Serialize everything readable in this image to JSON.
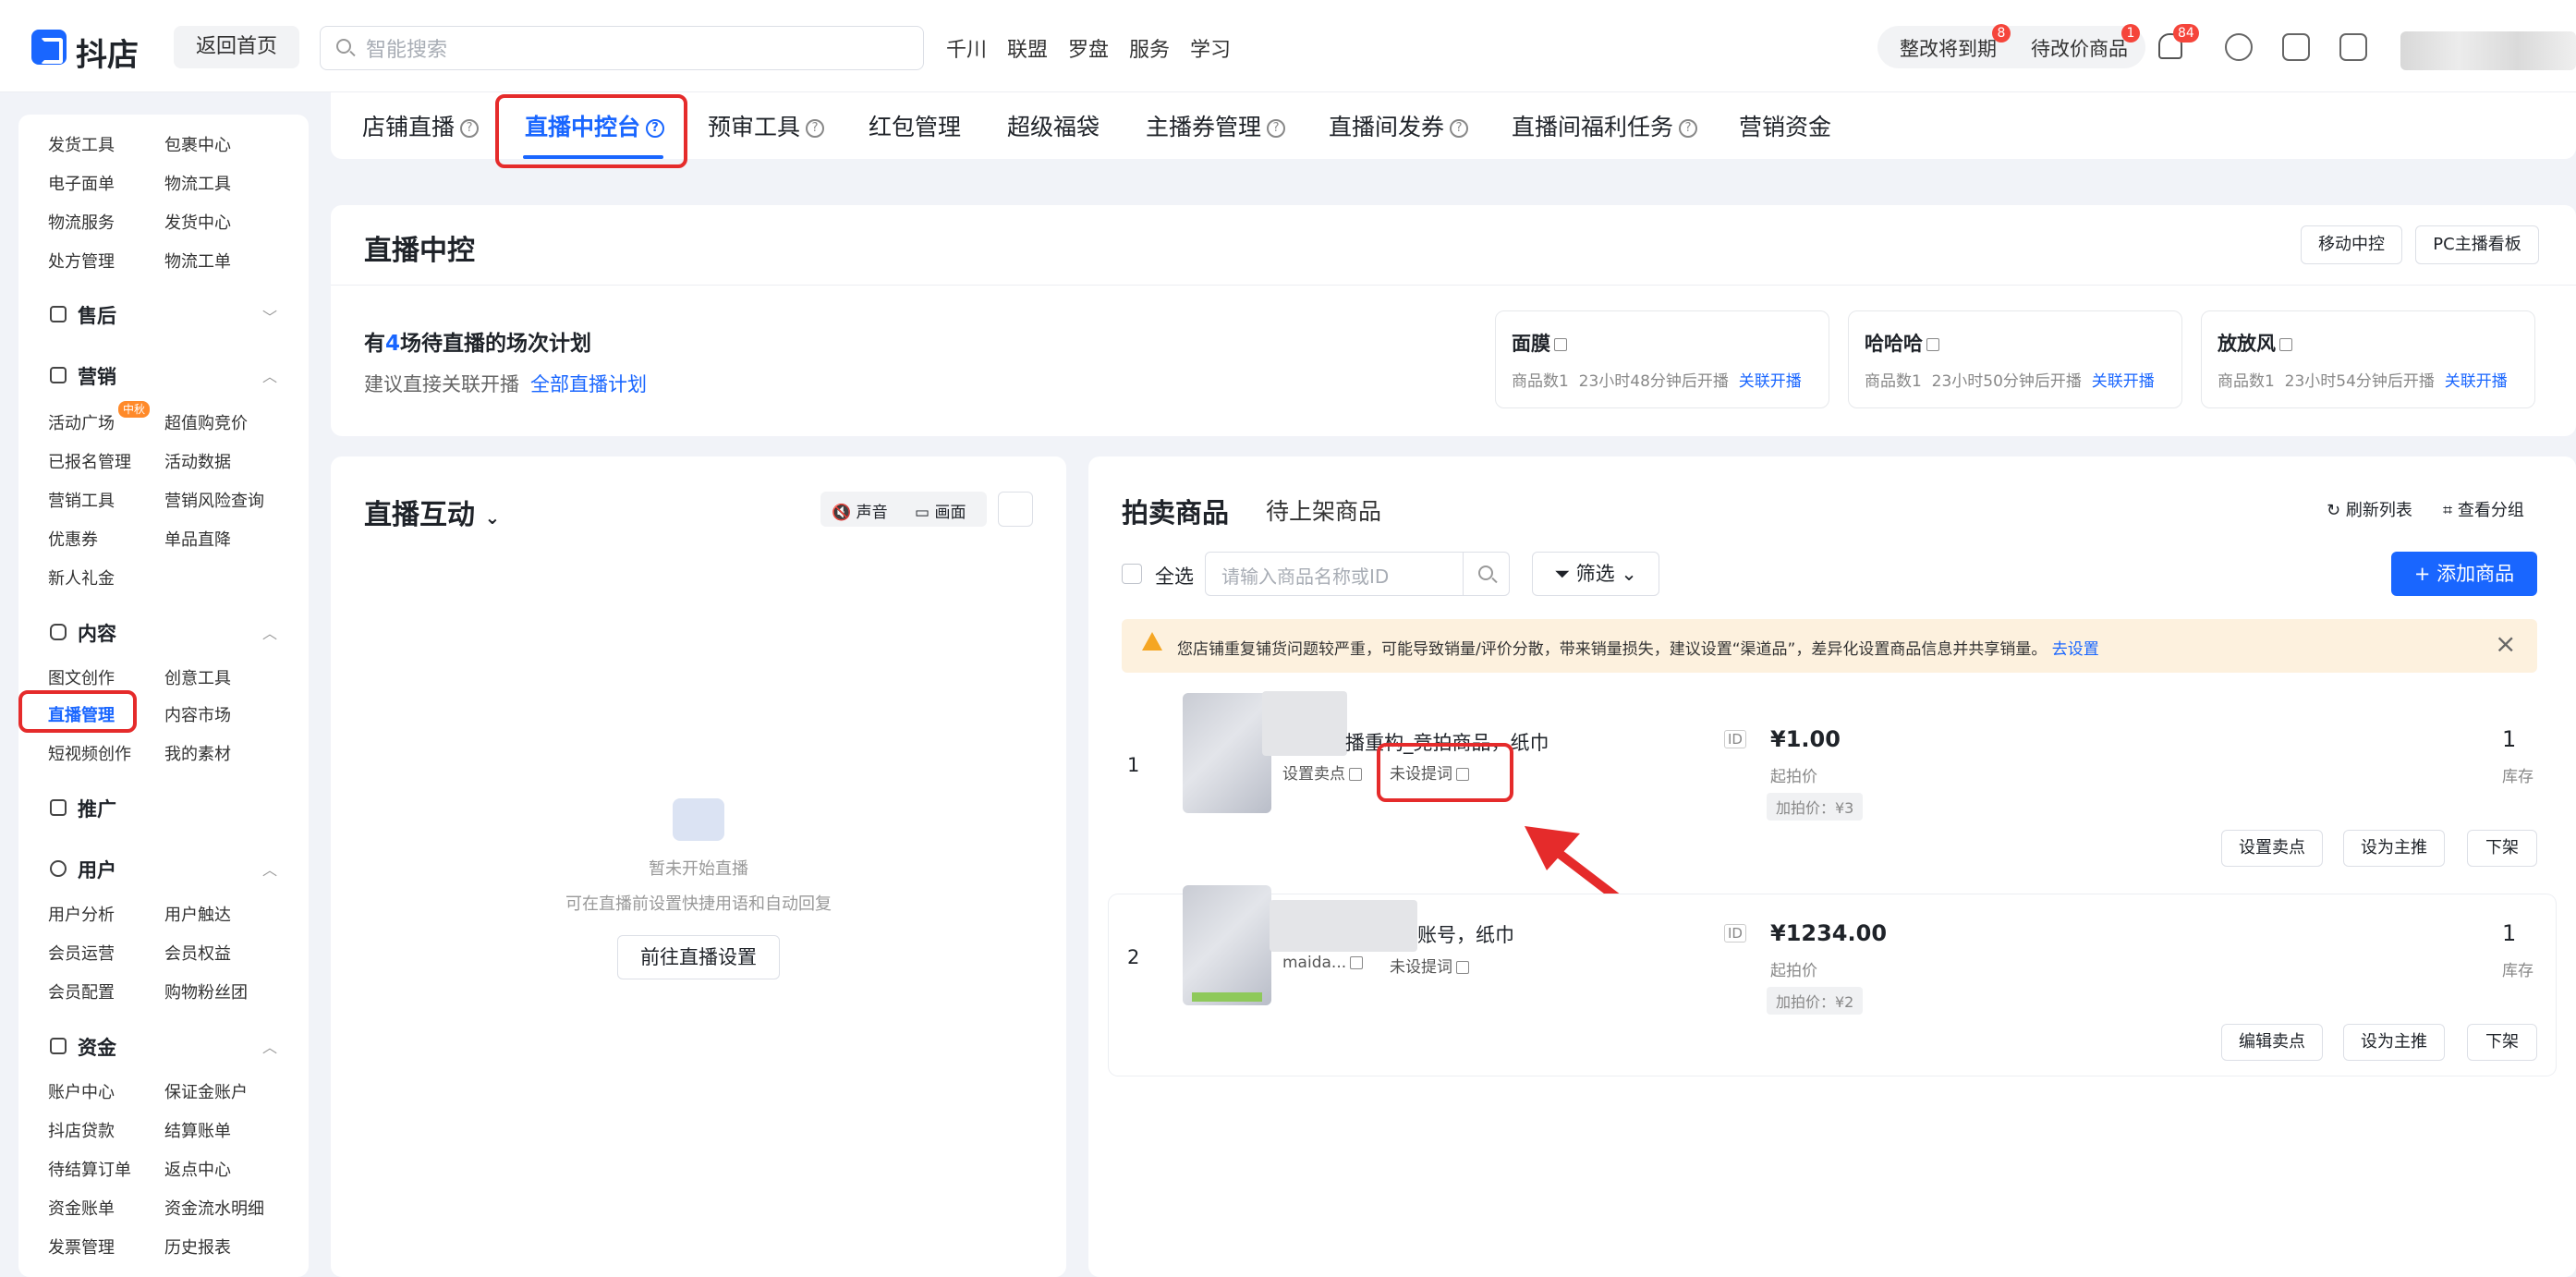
{
  "header": {
    "logo_text": "抖店",
    "home_button": "返回首页",
    "search_placeholder": "智能搜索",
    "nav": [
      "千川",
      "联盟",
      "罗盘",
      "服务",
      "学习"
    ],
    "rectify_label": "整改将到期",
    "rectify_badge": "8",
    "pending_label": "待改价商品",
    "pending_badge": "1",
    "bell_badge": "84"
  },
  "sidebar": {
    "top_items": [
      "发货工具",
      "包裹中心",
      "电子面单",
      "物流工具",
      "物流服务",
      "发货中心",
      "处方管理",
      "物流工单"
    ],
    "sections": {
      "after_sale": {
        "title": "售后"
      },
      "marketing": {
        "title": "营销",
        "badge": "中秋",
        "items": [
          "活动广场",
          "超值购竞价",
          "已报名管理",
          "活动数据",
          "营销工具",
          "营销风险查询",
          "优惠券",
          "单品直降",
          "新人礼金"
        ]
      },
      "content": {
        "title": "内容",
        "items": [
          "图文创作",
          "创意工具",
          "直播管理",
          "内容市场",
          "短视频创作",
          "我的素材"
        ]
      },
      "promotion": {
        "title": "推广"
      },
      "users": {
        "title": "用户",
        "items": [
          "用户分析",
          "用户触达",
          "会员运营",
          "会员权益",
          "会员配置",
          "购物粉丝团"
        ]
      },
      "funds": {
        "title": "资金",
        "items": [
          "账户中心",
          "保证金账户",
          "抖店贷款",
          "结算账单",
          "待结算订单",
          "返点中心",
          "资金账单",
          "资金流水明细",
          "发票管理",
          "历史报表"
        ]
      }
    }
  },
  "tabs": [
    "店铺直播",
    "直播中控台",
    "预审工具",
    "红包管理",
    "超级福袋",
    "主播券管理",
    "直播间发券",
    "直播间福利任务",
    "营销资金"
  ],
  "control": {
    "title": "直播中控",
    "mobile_btn": "移动中控",
    "pc_btn": "PC主播看板",
    "plan_pre": "有",
    "plan_count": "4",
    "plan_post": "场待直播的场次计划",
    "plan_hint": "建议直接关联开播",
    "plan_link": "全部直播计划",
    "sessions": [
      {
        "name": "面膜",
        "count": "商品数1",
        "time": "23小时48分钟后开播",
        "link": "关联开播"
      },
      {
        "name": "哈哈哈",
        "count": "商品数1",
        "time": "23小时50分钟后开播",
        "link": "关联开播"
      },
      {
        "name": "放放风",
        "count": "商品数1",
        "time": "23小时54分钟后开播",
        "link": "关联开播"
      }
    ]
  },
  "interaction": {
    "title": "直播互动",
    "sound": "声音",
    "picture": "画面",
    "empty_title": "暂未开始直播",
    "empty_desc": "可在直播前设置快捷用语和自动回复",
    "goto_btn": "前往直播设置"
  },
  "auction": {
    "tab_active": "拍卖商品",
    "tab_other": "待上架商品",
    "refresh": "刷新列表",
    "view_group": "查看分组",
    "select_all": "全选",
    "search_placeholder": "请输入商品名称或ID",
    "filter": "筛选",
    "add_btn": "+ 添加商品",
    "warning": "您店铺重复铺货问题较严重，可能导致销量/评价分散，带来销量损失，建议设置“渠道品”，差异化设置商品信息并共享销量。",
    "warning_link": "去设置",
    "items": [
      {
        "index": "1",
        "title": "播重构_竞拍商品，纸巾",
        "selling_point": "设置卖点",
        "prompt": "未设提词",
        "id_tag": "ID",
        "price": "¥1.00",
        "price_label": "起拍价",
        "increment": "加拍价：¥3",
        "stock": "1",
        "stock_label": "库存",
        "btn1": "设置卖点",
        "btn2": "设为主推",
        "btn3": "下架"
      },
      {
        "index": "2",
        "title": "账号，纸巾",
        "selling_point": "maida...",
        "prompt": "未设提词",
        "id_tag": "ID",
        "price": "¥1234.00",
        "price_label": "起拍价",
        "increment": "加拍价：¥2",
        "stock": "1",
        "stock_label": "库存",
        "btn1": "编辑卖点",
        "btn2": "设为主推",
        "btn3": "下架"
      }
    ]
  },
  "colors": {
    "accent": "#1966ff",
    "highlight": "#e52b2b",
    "warning_bg": "#fdf1de"
  }
}
